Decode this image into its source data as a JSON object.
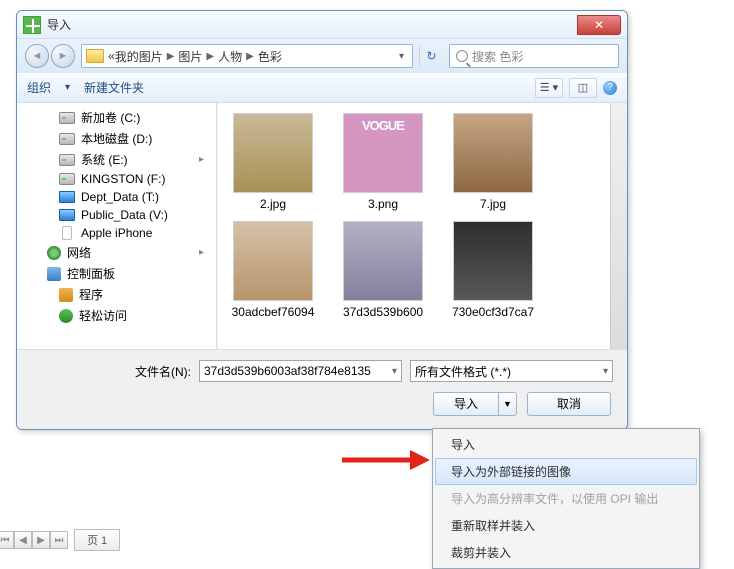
{
  "titlebar": {
    "title": "导入"
  },
  "path": {
    "prefix": "«",
    "crumbs": [
      "我的图片",
      "图片",
      "人物",
      "色彩"
    ]
  },
  "search": {
    "placeholder": "搜索 色彩"
  },
  "toolbar": {
    "organize": "组织",
    "new_folder": "新建文件夹"
  },
  "tree": {
    "items": [
      {
        "label": "新加卷 (C:)",
        "icon": "drive",
        "level": 2
      },
      {
        "label": "本地磁盘 (D:)",
        "icon": "drive",
        "level": 2
      },
      {
        "label": "系统 (E:)",
        "icon": "drive",
        "level": 2,
        "arrow": true
      },
      {
        "label": "KINGSTON (F:)",
        "icon": "drive",
        "level": 2
      },
      {
        "label": "Dept_Data (T:)",
        "icon": "net",
        "level": 2
      },
      {
        "label": "Public_Data (V:)",
        "icon": "net",
        "level": 2
      },
      {
        "label": "Apple iPhone",
        "icon": "phone",
        "level": 2
      },
      {
        "label": "网络",
        "icon": "network",
        "level": 1,
        "arrow": true
      },
      {
        "label": "控制面板",
        "icon": "cp",
        "level": 1
      },
      {
        "label": "程序",
        "icon": "prog",
        "level": 2
      },
      {
        "label": "轻松访问",
        "icon": "ease",
        "level": 2
      }
    ]
  },
  "files": {
    "items": [
      {
        "name": "2.jpg",
        "th": "th-model1"
      },
      {
        "name": "3.png",
        "th": "th-vogue"
      },
      {
        "name": "7.jpg",
        "th": "th-book"
      },
      {
        "name": "30adcbef76094",
        "th": "th-model2"
      },
      {
        "name": "37d3d539b600",
        "th": "th-street"
      },
      {
        "name": "730e0cf3d7ca7",
        "th": "th-dark"
      }
    ]
  },
  "bottom": {
    "filename_label": "文件名(N):",
    "filename_value": "37d3d539b6003af38f784e8135",
    "filter_value": "所有文件格式 (*.*)",
    "import_button": "导入",
    "cancel_button": "取消"
  },
  "dropdown": {
    "items": [
      {
        "label": "导入",
        "state": "normal"
      },
      {
        "label": "导入为外部链接的图像",
        "state": "hl"
      },
      {
        "label": "导入为高分辨率文件，以使用 OPI 输出",
        "state": "disabled"
      },
      {
        "label": "重新取样并装入",
        "state": "normal"
      },
      {
        "label": "裁剪并装入",
        "state": "normal"
      }
    ]
  },
  "page_tabs": {
    "page1": "页 1"
  }
}
